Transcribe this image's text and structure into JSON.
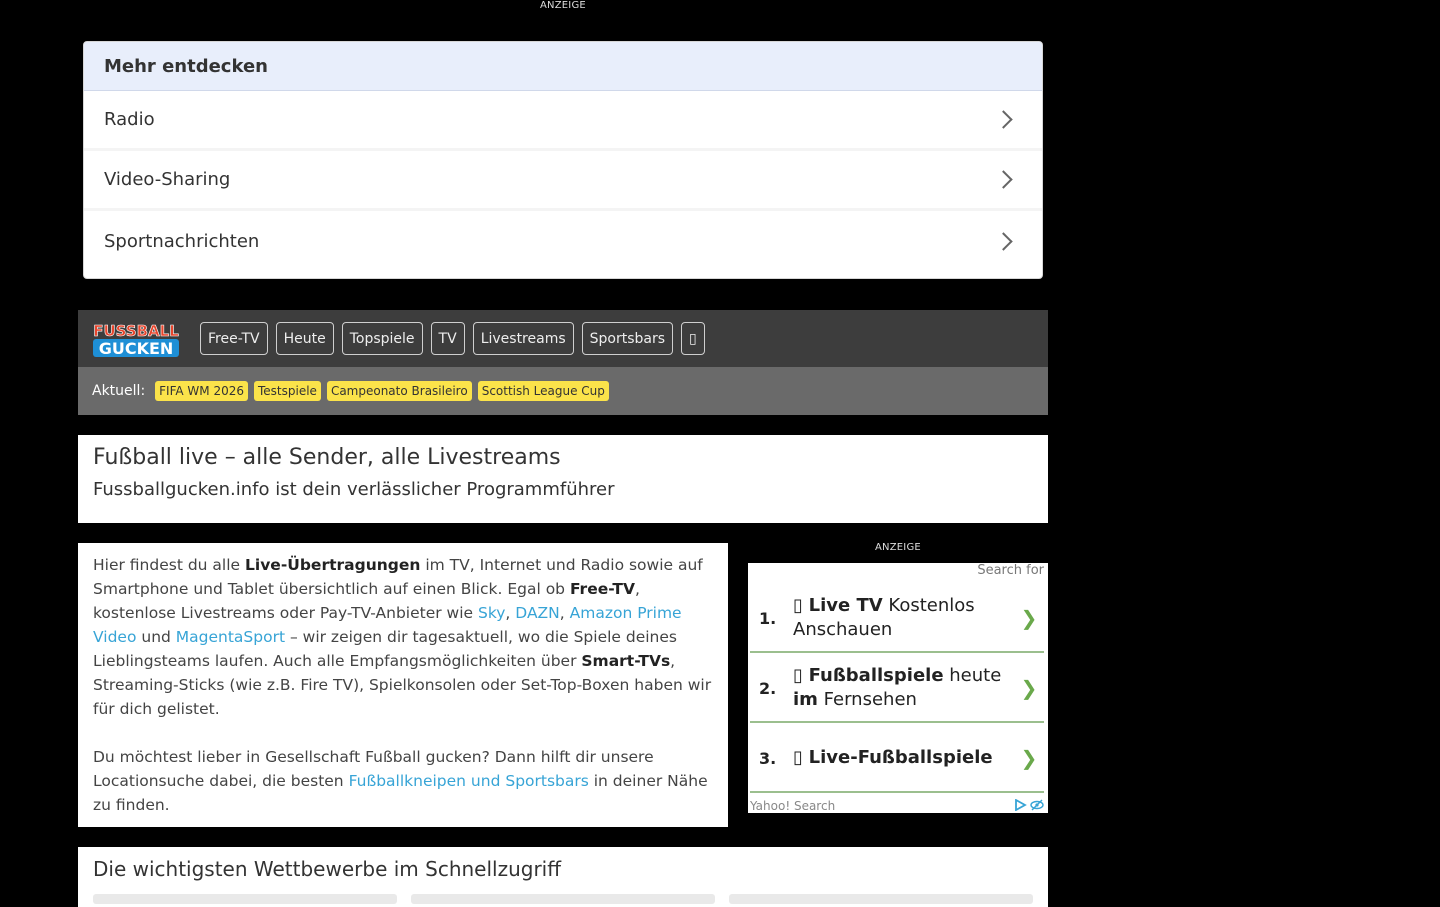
{
  "ads": {
    "top_label": "ANZEIGE",
    "side_label": "ANZEIGE"
  },
  "discover": {
    "title": "Mehr entdecken",
    "items": [
      {
        "label": "Radio"
      },
      {
        "label": "Video-Sharing"
      },
      {
        "label": "Sportnachrichten"
      }
    ]
  },
  "logo": {
    "line1": "FUSSBALL",
    "line2": "GUCKEN"
  },
  "nav": {
    "items": [
      {
        "label": "Free-TV"
      },
      {
        "label": "Heute"
      },
      {
        "label": "Topspiele"
      },
      {
        "label": "TV"
      },
      {
        "label": "Livestreams"
      },
      {
        "label": "Sportsbars"
      }
    ],
    "extra_glyph": "▯"
  },
  "current": {
    "label": "Aktuell:",
    "tags": [
      {
        "label": "FIFA WM 2026"
      },
      {
        "label": "Testspiele"
      },
      {
        "label": "Campeonato Brasileiro"
      },
      {
        "label": "Scottish League Cup"
      }
    ]
  },
  "hero": {
    "title": "Fußball live – alle Sender, alle Livestreams",
    "subtitle": "Fussballgucken.info ist dein verlässlicher Programmführer"
  },
  "intro": {
    "p1": {
      "t1": "Hier findest du alle ",
      "b1": "Live-Übertragungen",
      "t2": " im TV, Internet und Radio sowie auf Smartphone und Tablet übersichtlich auf einen Blick. Egal ob ",
      "b2": "Free-TV",
      "t3": ", kostenlose Livestreams oder Pay-TV-Anbieter wie ",
      "l1": "Sky",
      "t4": ", ",
      "l2": "DAZN",
      "t5": ", ",
      "l3": "Amazon Prime Video",
      "t6": " und ",
      "l4": "MagentaSport",
      "t7": " – wir zeigen dir tagesaktuell, wo die Spiele deines Lieblingsteams laufen. Auch alle Empfangsmöglichkeiten über ",
      "b3": "Smart-TVs",
      "t8": ", Streaming-Sticks (wie z.B. Fire TV), Spielkonsolen oder Set-Top-Boxen haben wir für dich gelistet."
    },
    "p2": {
      "t1": "Du möchtest lieber in Gesellschaft Fußball gucken? Dann hilft dir unsere Locationsuche dabei, die besten ",
      "l1": "Fußballkneipen und Sportsbars",
      "t2": " in deiner Nähe zu finden."
    }
  },
  "yahoo": {
    "search_for": "Search for",
    "results": [
      {
        "num": "1.",
        "glyph": "▯",
        "bold1": "Live TV",
        "rest1": " Kostenlos Anschauen",
        "bold2": "",
        "rest2": ""
      },
      {
        "num": "2.",
        "glyph": "▯",
        "bold1": "Fußballspiele",
        "rest1": " heute ",
        "bold2": "im",
        "rest2": " Fernsehen"
      },
      {
        "num": "3.",
        "glyph": "▯",
        "bold1": "Live-Fußballspiele",
        "rest1": "",
        "bold2": "",
        "rest2": ""
      }
    ],
    "arrow": "❯",
    "footer": "Yahoo! Search"
  },
  "competitions": {
    "title": "Die wichtigsten Wettbewerbe im Schnellzugriff"
  },
  "colors": {
    "accent": "#37a4d6",
    "tag": "#fbe34a",
    "nav_bg": "#3d3d3d",
    "discover_head": "#e8eefb"
  }
}
